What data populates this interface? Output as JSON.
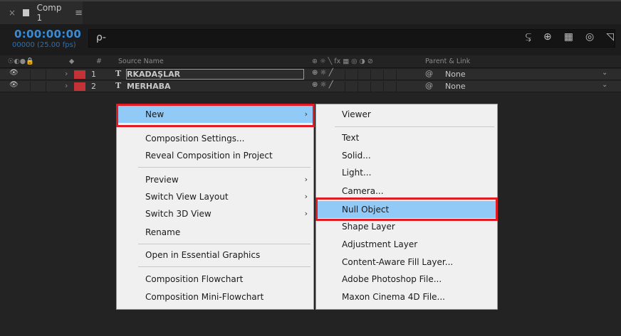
{
  "tab": {
    "close": "×",
    "title": "Comp 1",
    "menu": "≡"
  },
  "header": {
    "timecode": "0:00:00:00",
    "fps": "00000 (25.00 fps)",
    "search_icon": "ρ-"
  },
  "columns": {
    "switches": "☉◐●🔒",
    "label": "◆",
    "num": "#",
    "source_name": "Source Name",
    "layer_switches": "⊕ ☼ ╲ fx ▦ ◎ ◑ ⊘",
    "parent_link": "Parent & Link"
  },
  "layers": [
    {
      "num": "1",
      "type": "T",
      "name": "RKADAŞLAR",
      "parent": "None"
    },
    {
      "num": "2",
      "type": "T",
      "name": "MERHABA",
      "parent": "None"
    }
  ],
  "context_menu": {
    "items": [
      {
        "label": "New",
        "submenu": true,
        "highlighted": true
      },
      {
        "label": "Composition Settings..."
      },
      {
        "label": "Reveal Composition in Project"
      },
      {
        "label": "Preview",
        "submenu": true
      },
      {
        "label": "Switch View Layout",
        "submenu": true
      },
      {
        "label": "Switch 3D View",
        "submenu": true
      },
      {
        "label": "Rename"
      },
      {
        "label": "Open in Essential Graphics"
      },
      {
        "label": "Composition Flowchart"
      },
      {
        "label": "Composition Mini-Flowchart"
      }
    ],
    "submenu_arrow": "›"
  },
  "new_submenu": {
    "items": [
      {
        "label": "Viewer"
      },
      {
        "label": "Text"
      },
      {
        "label": "Solid..."
      },
      {
        "label": "Light..."
      },
      {
        "label": "Camera..."
      },
      {
        "label": "Null Object",
        "highlighted": true
      },
      {
        "label": "Shape Layer"
      },
      {
        "label": "Adjustment Layer"
      },
      {
        "label": "Content-Aware Fill Layer..."
      },
      {
        "label": "Adobe Photoshop File..."
      },
      {
        "label": "Maxon Cinema 4D File..."
      }
    ]
  },
  "colors": {
    "highlight": "#91c9f7",
    "annotation": "#e21b24",
    "timecode": "#3a8bd6",
    "layer_label": "#c23237"
  }
}
